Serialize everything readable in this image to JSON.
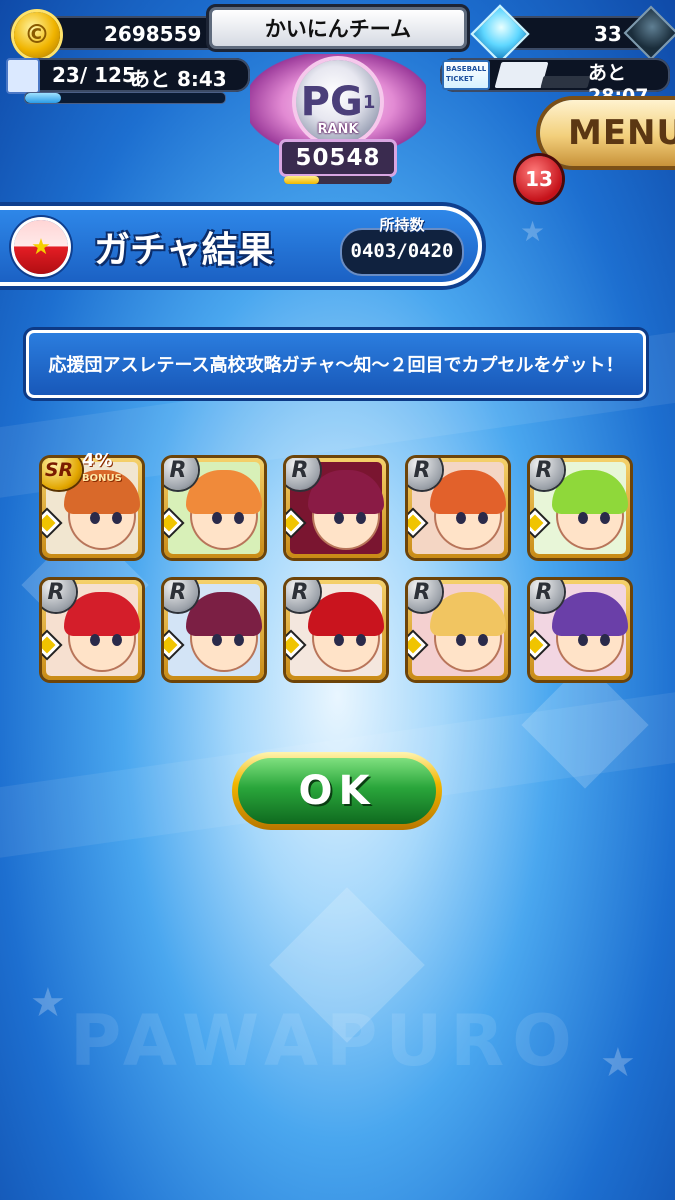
{
  "header": {
    "coins": "2698559",
    "team_name": "かいにんチーム",
    "gems": "33",
    "stamina_text": "23/ 125",
    "stamina_timer": "あと 8:43",
    "stamina_fraction": 0.18,
    "ticket_label_top": "BASEBALL",
    "ticket_label_bottom": "TICKET",
    "ticket_filled": 4,
    "ticket_total": 8,
    "ticket_timer": "あと28:07"
  },
  "rank": {
    "emblem": "PG",
    "sub": "1",
    "label": "RANK",
    "score": "50548",
    "progress": 0.32
  },
  "menu": {
    "label": "MENU",
    "badge": "13"
  },
  "title": {
    "text": "ガチャ結果",
    "count_label": "所持数",
    "count_value": "0403/0420"
  },
  "message": "応援団アスレテース高校攻略ガチャ～知～２回目でカプセルをゲット！",
  "bonus": {
    "value": "4%",
    "label": "BONUS"
  },
  "results": [
    {
      "rarity": "SR",
      "hair": "#d9692a",
      "bg": "#f1e6d0"
    },
    {
      "rarity": "R",
      "hair": "#f08a3a",
      "bg": "#d8f0b8"
    },
    {
      "rarity": "R",
      "hair": "#8a1b45",
      "bg": "#7a1530"
    },
    {
      "rarity": "R",
      "hair": "#e2612b",
      "bg": "#f4d6c4"
    },
    {
      "rarity": "R",
      "hair": "#8fd83a",
      "bg": "#e8f6d8"
    },
    {
      "rarity": "R",
      "hair": "#d41e2a",
      "bg": "#f6e0d0"
    },
    {
      "rarity": "R",
      "hair": "#7b1f44",
      "bg": "#d3e4f6"
    },
    {
      "rarity": "R",
      "hair": "#c9141e",
      "bg": "#f4e7de"
    },
    {
      "rarity": "R",
      "hair": "#f1c561",
      "bg": "#f4d0d0"
    },
    {
      "rarity": "R",
      "hair": "#6a3fa8",
      "bg": "#f2d6e2"
    }
  ],
  "ok_button": "OK"
}
